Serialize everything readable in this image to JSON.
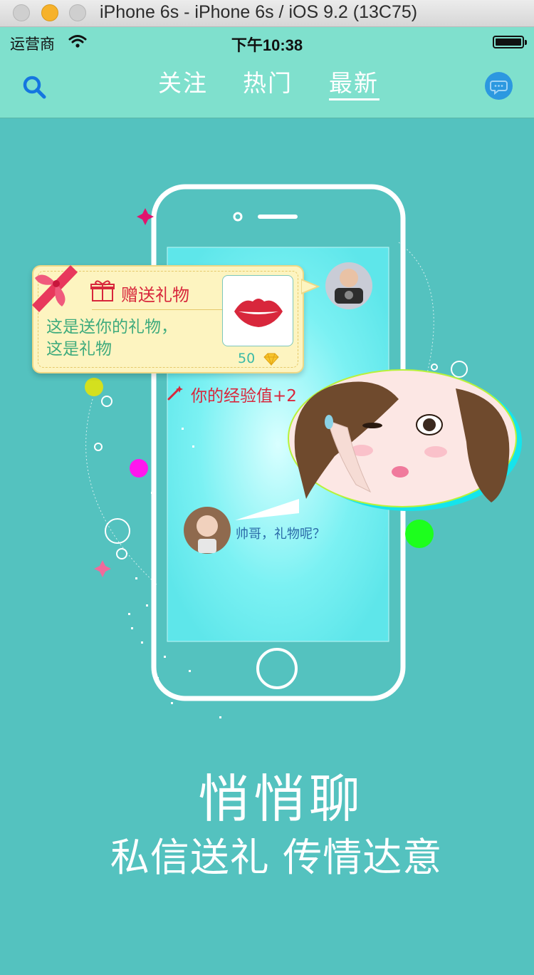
{
  "simulator": {
    "title": "iPhone 6s - iPhone 6s / iOS 9.2 (13C75)"
  },
  "status_bar": {
    "carrier": "运营商",
    "time": "下午10:38"
  },
  "nav": {
    "tabs": [
      {
        "label": "关注",
        "selected": false
      },
      {
        "label": "热门",
        "selected": false
      },
      {
        "label": "最新",
        "selected": true
      }
    ],
    "search_icon": "search-icon",
    "message_icon": "chat-bubble-icon"
  },
  "illustration": {
    "gift_card": {
      "title": "赠送礼物",
      "message_line1": "这是送你的礼物，",
      "message_line2": "这是礼物",
      "price": "50"
    },
    "exp_text": "你的经验值+2",
    "reply_text": "帅哥，礼物呢？"
  },
  "slogan": {
    "title": "悄悄聊",
    "subtitle": "私信送礼 传情达意"
  },
  "colors": {
    "background": "#54c2bf",
    "header": "#7fe0cd",
    "accent_red": "#d8273c",
    "accent_blue": "#2c98e0"
  }
}
